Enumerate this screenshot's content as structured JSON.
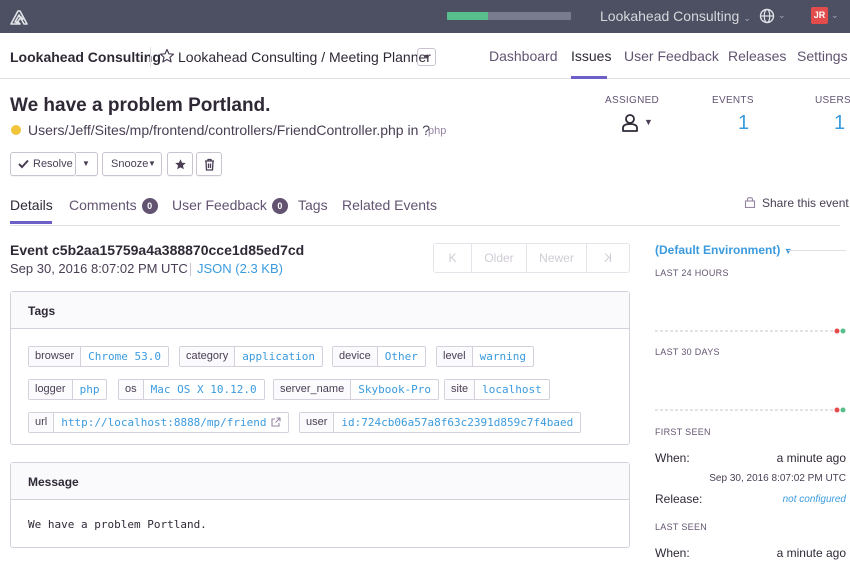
{
  "topbar": {
    "sync_progress": 0.33,
    "org_switcher": "Lookahead Consulting",
    "avatar_initials": "JR"
  },
  "subheader": {
    "org_name": "Lookahead Consulting",
    "project_path": "Lookahead Consulting / Meeting Planner",
    "nav": [
      "Dashboard",
      "Issues",
      "User Feedback",
      "Releases",
      "Settings"
    ],
    "active_nav": "Issues"
  },
  "issue": {
    "title": "We have a problem Portland.",
    "culprit": "Users/Jeff/Sites/mp/frontend/controllers/FriendController.php in ?",
    "platform": "php",
    "level_color": "#f1c43c",
    "stats": {
      "assigned_label": "ASSIGNED",
      "events_label": "EVENTS",
      "events_value": "1",
      "users_label": "USERS",
      "users_value": "1"
    }
  },
  "actions": {
    "resolve": "Resolve",
    "snooze": "Snooze"
  },
  "tabs": {
    "details": "Details",
    "comments": "Comments",
    "comments_count": "0",
    "user_feedback": "User Feedback",
    "user_feedback_count": "0",
    "tags": "Tags",
    "related_events": "Related Events",
    "share": "Share this event"
  },
  "event": {
    "id": "Event c5b2aa15759a4a388870cce1d85ed7cd",
    "date": "Sep 30, 2016 8:07:02 PM UTC",
    "json_link": "JSON (2.3 KB)",
    "pager": {
      "first": "K",
      "older": "Older",
      "newer": "Newer",
      "last": "K"
    }
  },
  "tags_panel": {
    "title": "Tags",
    "tags": [
      {
        "key": "browser",
        "value": "Chrome 53.0"
      },
      {
        "key": "category",
        "value": "application"
      },
      {
        "key": "device",
        "value": "Other"
      },
      {
        "key": "level",
        "value": "warning"
      },
      {
        "key": "logger",
        "value": "php"
      },
      {
        "key": "os",
        "value": "Mac OS X 10.12.0"
      },
      {
        "key": "server_name",
        "value": "Skybook-Pro"
      },
      {
        "key": "site",
        "value": "localhost"
      },
      {
        "key": "url",
        "value": "http://localhost:8888/mp/friend"
      },
      {
        "key": "user",
        "value": "id:724cb06a57a8f63c2391d859c7f4baed"
      }
    ]
  },
  "message_panel": {
    "title": "Message",
    "text": "We have a problem Portland."
  },
  "sidebar": {
    "environment": "(Default Environment)",
    "last_24_hours": "LAST 24 HOURS",
    "last_30_days": "LAST 30 DAYS",
    "first_seen": {
      "label": "FIRST SEEN",
      "when_label": "When:",
      "when_value": "a minute ago",
      "date": "Sep 30, 2016 8:07:02 PM UTC",
      "release_label": "Release:",
      "release_value": "not configured"
    },
    "last_seen": {
      "label": "LAST SEEN",
      "when_label": "When:",
      "when_value": "a minute ago"
    }
  }
}
